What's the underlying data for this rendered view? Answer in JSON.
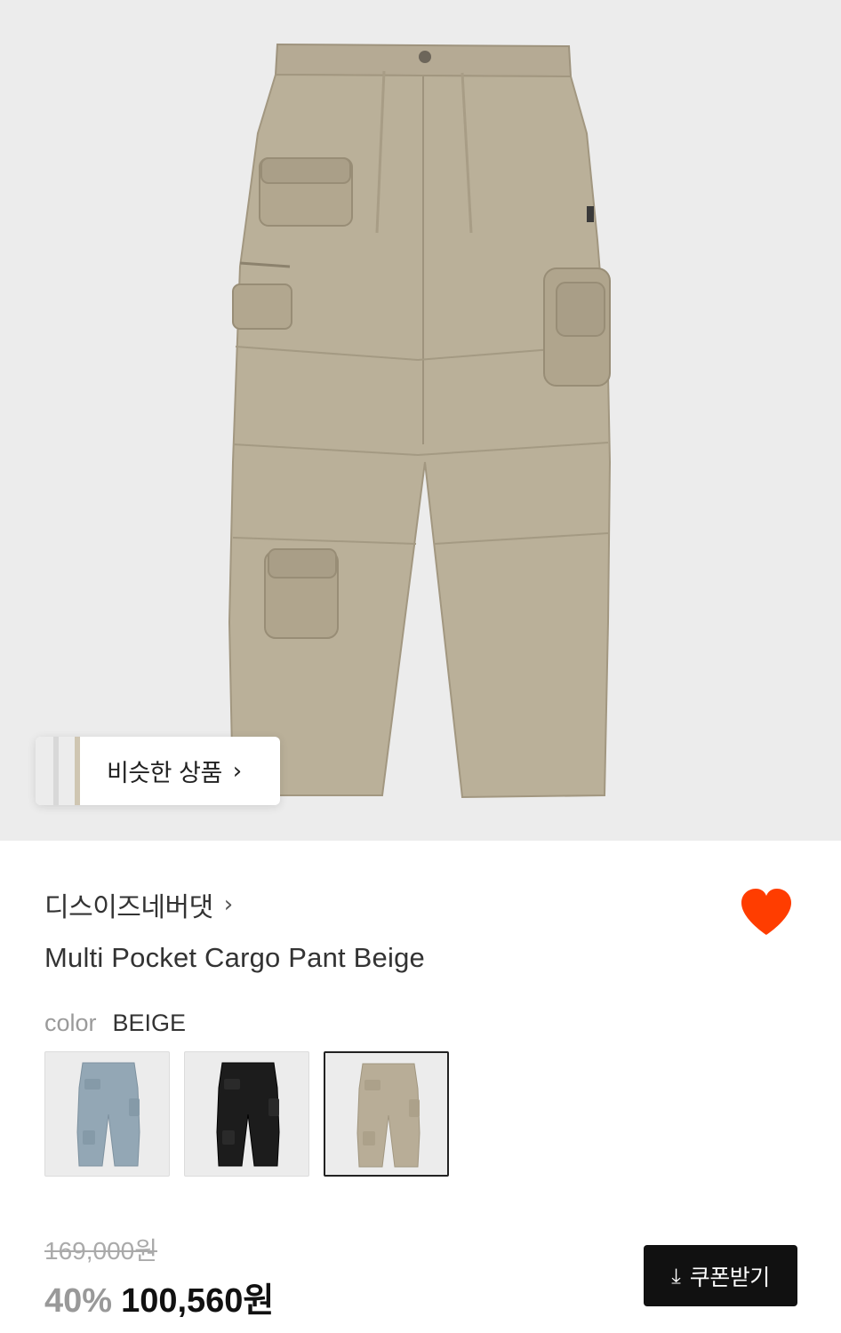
{
  "hero": {
    "similar_label": "비슷한 상품",
    "similar_arrow": "›"
  },
  "product": {
    "brand": "디스이즈네버댓",
    "brand_arrow": "›",
    "title": "Multi Pocket Cargo Pant Beige",
    "liked": true,
    "color_label": "color",
    "color_value": "BEIGE"
  },
  "swatches": [
    {
      "name": "blue-grey",
      "color": "#93a7b5",
      "selected": false
    },
    {
      "name": "black",
      "color": "#1c1c1c",
      "selected": false
    },
    {
      "name": "beige",
      "color": "#b8ad97",
      "selected": true
    }
  ],
  "price": {
    "original": "169,000원",
    "discount": "40%",
    "sale": "100,560원"
  },
  "coupon": {
    "icon": "download-icon",
    "label": "쿠폰받기"
  },
  "colors": {
    "heart": "#ff3d00",
    "hero_bg": "#ececec",
    "pants_beige": "#b8ad97",
    "button_bg": "#111111"
  }
}
